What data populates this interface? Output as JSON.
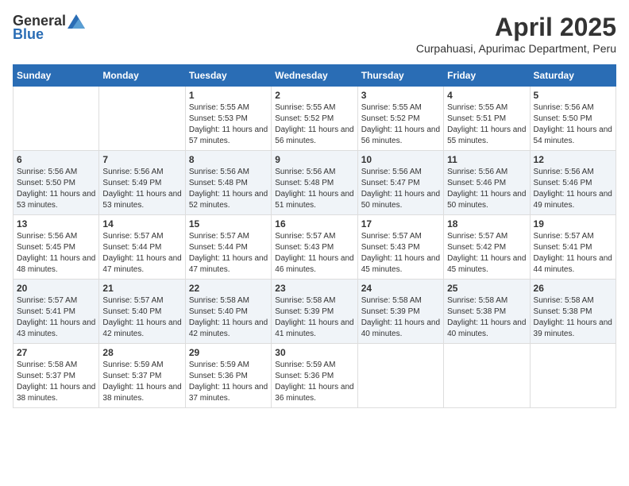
{
  "header": {
    "logo_general": "General",
    "logo_blue": "Blue",
    "month_year": "April 2025",
    "location": "Curpahuasi, Apurimac Department, Peru"
  },
  "weekdays": [
    "Sunday",
    "Monday",
    "Tuesday",
    "Wednesday",
    "Thursday",
    "Friday",
    "Saturday"
  ],
  "weeks": [
    [
      {
        "day": "",
        "sunrise": "",
        "sunset": "",
        "daylight": ""
      },
      {
        "day": "",
        "sunrise": "",
        "sunset": "",
        "daylight": ""
      },
      {
        "day": "1",
        "sunrise": "Sunrise: 5:55 AM",
        "sunset": "Sunset: 5:53 PM",
        "daylight": "Daylight: 11 hours and 57 minutes."
      },
      {
        "day": "2",
        "sunrise": "Sunrise: 5:55 AM",
        "sunset": "Sunset: 5:52 PM",
        "daylight": "Daylight: 11 hours and 56 minutes."
      },
      {
        "day": "3",
        "sunrise": "Sunrise: 5:55 AM",
        "sunset": "Sunset: 5:52 PM",
        "daylight": "Daylight: 11 hours and 56 minutes."
      },
      {
        "day": "4",
        "sunrise": "Sunrise: 5:55 AM",
        "sunset": "Sunset: 5:51 PM",
        "daylight": "Daylight: 11 hours and 55 minutes."
      },
      {
        "day": "5",
        "sunrise": "Sunrise: 5:56 AM",
        "sunset": "Sunset: 5:50 PM",
        "daylight": "Daylight: 11 hours and 54 minutes."
      }
    ],
    [
      {
        "day": "6",
        "sunrise": "Sunrise: 5:56 AM",
        "sunset": "Sunset: 5:50 PM",
        "daylight": "Daylight: 11 hours and 53 minutes."
      },
      {
        "day": "7",
        "sunrise": "Sunrise: 5:56 AM",
        "sunset": "Sunset: 5:49 PM",
        "daylight": "Daylight: 11 hours and 53 minutes."
      },
      {
        "day": "8",
        "sunrise": "Sunrise: 5:56 AM",
        "sunset": "Sunset: 5:48 PM",
        "daylight": "Daylight: 11 hours and 52 minutes."
      },
      {
        "day": "9",
        "sunrise": "Sunrise: 5:56 AM",
        "sunset": "Sunset: 5:48 PM",
        "daylight": "Daylight: 11 hours and 51 minutes."
      },
      {
        "day": "10",
        "sunrise": "Sunrise: 5:56 AM",
        "sunset": "Sunset: 5:47 PM",
        "daylight": "Daylight: 11 hours and 50 minutes."
      },
      {
        "day": "11",
        "sunrise": "Sunrise: 5:56 AM",
        "sunset": "Sunset: 5:46 PM",
        "daylight": "Daylight: 11 hours and 50 minutes."
      },
      {
        "day": "12",
        "sunrise": "Sunrise: 5:56 AM",
        "sunset": "Sunset: 5:46 PM",
        "daylight": "Daylight: 11 hours and 49 minutes."
      }
    ],
    [
      {
        "day": "13",
        "sunrise": "Sunrise: 5:56 AM",
        "sunset": "Sunset: 5:45 PM",
        "daylight": "Daylight: 11 hours and 48 minutes."
      },
      {
        "day": "14",
        "sunrise": "Sunrise: 5:57 AM",
        "sunset": "Sunset: 5:44 PM",
        "daylight": "Daylight: 11 hours and 47 minutes."
      },
      {
        "day": "15",
        "sunrise": "Sunrise: 5:57 AM",
        "sunset": "Sunset: 5:44 PM",
        "daylight": "Daylight: 11 hours and 47 minutes."
      },
      {
        "day": "16",
        "sunrise": "Sunrise: 5:57 AM",
        "sunset": "Sunset: 5:43 PM",
        "daylight": "Daylight: 11 hours and 46 minutes."
      },
      {
        "day": "17",
        "sunrise": "Sunrise: 5:57 AM",
        "sunset": "Sunset: 5:43 PM",
        "daylight": "Daylight: 11 hours and 45 minutes."
      },
      {
        "day": "18",
        "sunrise": "Sunrise: 5:57 AM",
        "sunset": "Sunset: 5:42 PM",
        "daylight": "Daylight: 11 hours and 45 minutes."
      },
      {
        "day": "19",
        "sunrise": "Sunrise: 5:57 AM",
        "sunset": "Sunset: 5:41 PM",
        "daylight": "Daylight: 11 hours and 44 minutes."
      }
    ],
    [
      {
        "day": "20",
        "sunrise": "Sunrise: 5:57 AM",
        "sunset": "Sunset: 5:41 PM",
        "daylight": "Daylight: 11 hours and 43 minutes."
      },
      {
        "day": "21",
        "sunrise": "Sunrise: 5:57 AM",
        "sunset": "Sunset: 5:40 PM",
        "daylight": "Daylight: 11 hours and 42 minutes."
      },
      {
        "day": "22",
        "sunrise": "Sunrise: 5:58 AM",
        "sunset": "Sunset: 5:40 PM",
        "daylight": "Daylight: 11 hours and 42 minutes."
      },
      {
        "day": "23",
        "sunrise": "Sunrise: 5:58 AM",
        "sunset": "Sunset: 5:39 PM",
        "daylight": "Daylight: 11 hours and 41 minutes."
      },
      {
        "day": "24",
        "sunrise": "Sunrise: 5:58 AM",
        "sunset": "Sunset: 5:39 PM",
        "daylight": "Daylight: 11 hours and 40 minutes."
      },
      {
        "day": "25",
        "sunrise": "Sunrise: 5:58 AM",
        "sunset": "Sunset: 5:38 PM",
        "daylight": "Daylight: 11 hours and 40 minutes."
      },
      {
        "day": "26",
        "sunrise": "Sunrise: 5:58 AM",
        "sunset": "Sunset: 5:38 PM",
        "daylight": "Daylight: 11 hours and 39 minutes."
      }
    ],
    [
      {
        "day": "27",
        "sunrise": "Sunrise: 5:58 AM",
        "sunset": "Sunset: 5:37 PM",
        "daylight": "Daylight: 11 hours and 38 minutes."
      },
      {
        "day": "28",
        "sunrise": "Sunrise: 5:59 AM",
        "sunset": "Sunset: 5:37 PM",
        "daylight": "Daylight: 11 hours and 38 minutes."
      },
      {
        "day": "29",
        "sunrise": "Sunrise: 5:59 AM",
        "sunset": "Sunset: 5:36 PM",
        "daylight": "Daylight: 11 hours and 37 minutes."
      },
      {
        "day": "30",
        "sunrise": "Sunrise: 5:59 AM",
        "sunset": "Sunset: 5:36 PM",
        "daylight": "Daylight: 11 hours and 36 minutes."
      },
      {
        "day": "",
        "sunrise": "",
        "sunset": "",
        "daylight": ""
      },
      {
        "day": "",
        "sunrise": "",
        "sunset": "",
        "daylight": ""
      },
      {
        "day": "",
        "sunrise": "",
        "sunset": "",
        "daylight": ""
      }
    ]
  ]
}
